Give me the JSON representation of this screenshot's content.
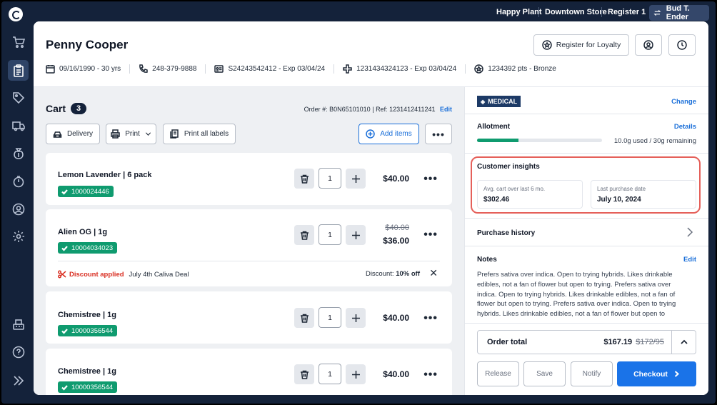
{
  "topbar": {
    "store_name": "Happy Plant",
    "location": "Downtown Store",
    "register": "Register 1",
    "user": "Bud T. Ender"
  },
  "customer": {
    "name": "Penny Cooper",
    "dob": "09/16/1990 - 30 yrs",
    "phone": "248-379-9888",
    "id_number": "S24243542412 - Exp 03/04/24",
    "medical_id": "1231434324123 - Exp 03/04/24",
    "loyalty": "1234392 pts - Bronze",
    "register_loyalty_label": "Register for Loyalty"
  },
  "cart": {
    "title": "Cart",
    "count": "3",
    "order_number": "Order #: B0N65101010",
    "ref": "Ref: 1231412411241",
    "edit_label": "Edit",
    "delivery_label": "Delivery",
    "print_label": "Print",
    "print_all_label": "Print all labels",
    "add_items_label": "Add items",
    "items": [
      {
        "name": "Lemon Lavender | 6 pack",
        "sku": "1000024446",
        "qty": "1",
        "price": "$40.00"
      },
      {
        "name": "Alien OG | 1g",
        "sku": "10004034023",
        "qty": "1",
        "old_price": "$40.00",
        "price": "$36.00",
        "discount_label": "Discount applied",
        "discount_name": "July 4th Caliva Deal",
        "discount_prefix": "Discount:",
        "discount_value": "10% off"
      },
      {
        "name": "Chemistree | 1g",
        "sku": "10000356544",
        "qty": "1",
        "price": "$40.00"
      },
      {
        "name": "Chemistree | 1g",
        "sku": "10000356544",
        "qty": "1",
        "price": "$40.00"
      }
    ]
  },
  "side": {
    "type_badge": "MEDICAL",
    "change_label": "Change",
    "allotment_title": "Allotment",
    "details_label": "Details",
    "allotment_used_fraction": 0.333,
    "allotment_text": "10.0g used / 30g remaining",
    "insights_title": "Customer insights",
    "insights": [
      {
        "label": "Avg. cart over last 6 mo.",
        "value": "$302.46"
      },
      {
        "label": "Last purchase date",
        "value": "July 10, 2024"
      }
    ],
    "purchase_history_label": "Purchase history",
    "notes_title": "Notes",
    "notes_edit": "Edit",
    "notes_text": "Prefers sativa over indica. Open to trying hybrids. Likes drinkable edibles, not a fan of flower but open to trying. Prefers sativa over indica. Open to trying hybrids. Likes drinkable edibles, not a fan of flower but open to trying. Prefers sativa over indica. Open to trying hybrids. Likes drinkable edibles, not a fan of flower but open to",
    "order_total_label": "Order total",
    "order_total": "$167.19",
    "order_total_old": "$172/95",
    "release_label": "Release",
    "save_label": "Save",
    "notify_label": "Notify",
    "checkout_label": "Checkout"
  },
  "colors": {
    "nav_bg": "#14223a",
    "accent": "#1a73e8",
    "sku_green": "#0f9b6f",
    "discount_red": "#d92d20",
    "highlight": "#e5605a"
  }
}
